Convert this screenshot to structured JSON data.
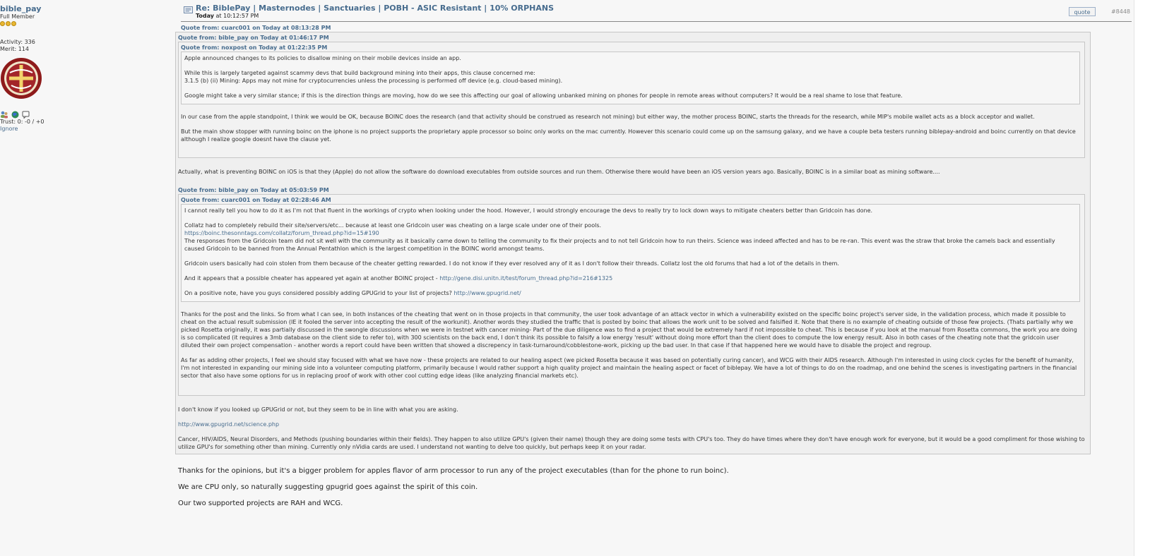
{
  "profile": {
    "username": "bible_pay",
    "rank": "Full Member",
    "activity": "Activity: 336",
    "merit": "Merit: 114",
    "trust": "Trust: 0: -0 / +0",
    "ignore": "Ignore"
  },
  "post": {
    "subject": "Re: BiblePay | Masternodes | Sanctuaries | POBH - ASIC Resistant | 10% ORPHANS",
    "date_label": "Today",
    "date_time": "at 10:12:57 PM",
    "quote_button": "quote",
    "post_number": "#8448"
  },
  "quote1": {
    "header": "Quote from: cuarc001 on Today at 08:13:28 PM",
    "closing": "I don't know if you looked up GPUGrid or not, but they seem to be in line with what you are asking.",
    "link": "http://www.gpugrid.net/science.php",
    "last": "Cancer, HIV/AIDS, Neural Disorders, and Methods (pushing boundaries within their fields). They happen to also utilize GPU's (given their name) though they are doing some tests with CPU's too. They do have times where they don't have enough work for everyone, but it would be a good compliment for those wishing to utilize GPU's for something other than mining. Currently only nVidia cards are used.  I understand not wanting to delve too quickly, but perhaps keep it on your radar.",
    "between": "Actually, what is preventing BOINC on iOS is that they (Apple) do not allow the software do download executables from outside sources and run them. Otherwise there would have been an iOS version years ago. Basically, BOINC is in a similar boat as mining software...."
  },
  "quote2a": {
    "header": "Quote from: bible_pay on Today at 01:46:17 PM",
    "reply1": "In our case from the apple standpoint, I think we would be OK, because BOINC does the research (and that activity should be construed as research not mining) but either way, the mother process BOINC, starts the threads for the research, while MIP's mobile wallet acts as a block acceptor and wallet.",
    "reply2": "But the main show stopper with running boinc on the iphone is no project supports the proprietary apple processor so boinc only works on the mac currently.  However this scenario could come up on the samsung galaxy, and we have a couple beta testers running biblepay-android and boinc currently on that device although I realize google doesnt have the clause yet."
  },
  "quote3a": {
    "header": "Quote from: noxpost on Today at 01:22:35 PM",
    "p1": "Apple announced changes to its policies to disallow mining on their mobile devices inside an app.",
    "p2a": "While this is largely targeted against scammy devs that build background mining into their apps, this clause concerned me:",
    "p2b": "3.1.5 (b) (ii) Mining: Apps may not mine for cryptocurrencies unless the processing is performed off device (e.g. cloud-based mining).",
    "p3": "Google might take a very similar stance; if this is the direction things are moving, how do we see this affecting our goal of allowing unbanked mining on phones for people in remote areas without computers? It would be a real shame to lose that feature."
  },
  "quote2b": {
    "header": "Quote from: bible_pay on Today at 05:03:59 PM",
    "reply1": "Thanks for the post and the links.  So from what I can see, in both instances of the cheating that went on in those projects in that community, the user took advantage of an attack vector in which a vulnerability existed on the specific boinc project's server side, in the validation process, which made it possible to cheat on the actual result submission (IE it fooled the server into accepting the result of the workunit). Another words they studied the traffic that is posted by boinc that allows the work unit to be solved and falsified it.  Note that there is no example of cheating outside of those few projects.  (Thats partially why we picked Rosetta originally, it was partially discussed in the swongle discussions when we were in testnet with cancer mining-  Part of the due diligence was to find a project that would be extremely hard if not impossible to cheat.  This is because if you look at the manual from Rosetta commons, the work you are doing is so complicated (it requires a 3mb database on the client side to refer to), with 300 scientists on the back end, I don't think its possible to falsify a low energy 'result' without doing more effort than the client does to compute the low energy result.  Also in both cases of the cheating note that the gridcoin user diluted their own project compensation - another words a report could have been written that showed a discrepency in task-turnaround/cobblestone-work, picking up the bad user.  In that case if that happened here we would have to disable the project and regroup.",
    "reply2": "As far as adding other projects, I feel we should stay focused with what we have now - these projects are related to our healing aspect (we picked Rosetta because it was based on potentially curing cancer), and WCG with their AIDS research.  Although I'm interested in using clock cycles for the benefit of humanity, I'm not interested in expanding our mining side into a volunteer computing platform, primarily because I would rather support a high quality project and maintain the healing aspect or facet of biblepay.  We have a lot of things to do on the roadmap, and one behind the scenes is investigating partners in the financial sector that also have some options for us in replacing proof of work with other cool cutting edge ideas (like analyzing financial markets etc)."
  },
  "quote3b": {
    "header": "Quote from: cuarc001 on Today at 02:28:46 AM",
    "p1": "I cannot really tell you how to do it as I'm not that fluent in the workings of crypto when looking under the hood. However, I would strongly encourage the devs to really try to lock down ways to mitigate cheaters better than Gridcoin has done.",
    "p2": "Collatz had to completely rebuild their site/servers/etc... because at least one Gridcoin user was cheating on a large scale  under one of their pools.",
    "p2link": "https://boinc.thesonntags.com/collatz/forum_thread.php?id=15#190",
    "p2b": "The responses from the Gridcoin team did not sit well with the community as it basically came down to telling the community to fix their projects and to not tell Gridcoin how to run theirs. Science was indeed affected and has to be re-ran. This event was the straw that broke the camels back and essentially caused Gridcoin to be banned from the Annual Pentathlon which is the largest competition in the BOINC world amongst teams.",
    "p3": "Gridcoin users basically had coin stolen from them because of the cheater getting rewarded. I do not know if they ever resolved any of it as I don't follow their threads. Collatz lost the old forums that had a lot of the details in them.",
    "p4": "And it appears that a possible cheater has appeared yet again at another BOINC project -",
    "p4link": "http://gene.disi.unitn.it/test/forum_thread.php?id=216#1325",
    "p5": "On a positive note, have you guys considered possibly adding GPUGrid to your list of projects?",
    "p5link": "http://www.gpugrid.net/"
  },
  "reply": {
    "l1": "Thanks for the opinions, but it's a bigger problem for apples flavor of arm processor to run any of the project executables (than for the phone to run boinc).",
    "l2": "We are CPU only, so naturally suggesting gpugrid goes against the spirit of this coin.",
    "l3": "Our two supported projects are RAH and WCG."
  }
}
